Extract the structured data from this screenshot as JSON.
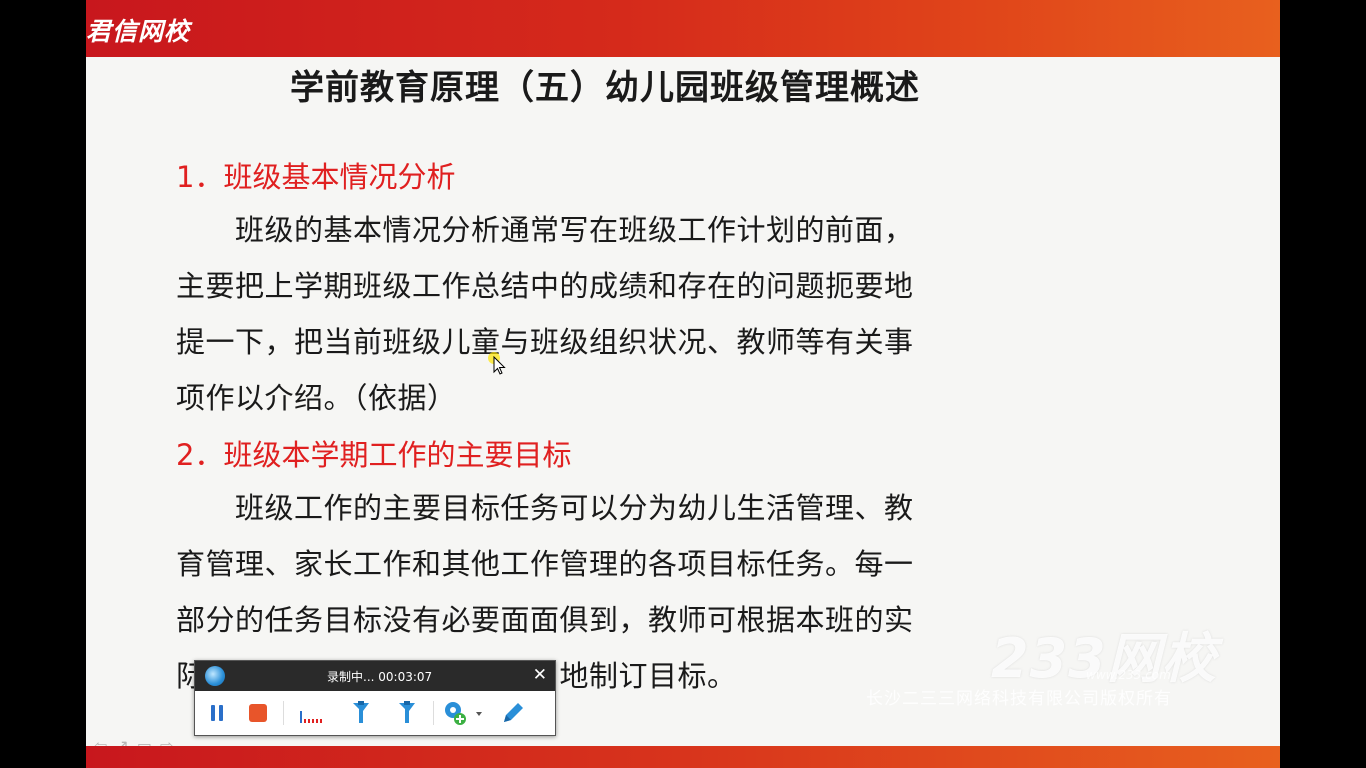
{
  "header": {
    "brand": "君信网校"
  },
  "slide": {
    "title": "学前教育原理（五）幼儿园班级管理概述",
    "section1": {
      "heading": "1．班级基本情况分析",
      "lines": [
        "　　班级的基本情况分析通常写在班级工作计划的前面，",
        "主要把上学期班级工作总结中的成绩和存在的问题扼要地",
        "提一下，把当前班级儿童与班级组织状况、教师等有关事",
        "项作以介绍。（依据）"
      ]
    },
    "section2": {
      "heading": "2．班级本学期工作的主要目标",
      "lines": [
        "　　班级工作的主要目标任务可以分为幼儿生活管理、教",
        "育管理、家长工作和其他工作管理的各项目标任务。每一",
        "部分的任务目标没有必要面面俱到，教师可根据本班的实",
        "际　　　　　　　　　　　　地制订目标。"
      ]
    },
    "watermark": {
      "logo": "233网校",
      "url": "www.233.com",
      "copyright": "长沙二三三网络科技有限公司版权所有"
    }
  },
  "recorder": {
    "status": "录制中...  00:03:07",
    "close": "✕",
    "tools": [
      "pause-icon",
      "stop-icon",
      "audio-level-icon",
      "pen-marker-icon",
      "highlighter-icon",
      "webcam-add-icon",
      "edit-pencil-icon"
    ]
  },
  "colors": {
    "accent_red": "#e02020",
    "bar_red": "#c8171d",
    "bar_orange": "#e8601e"
  }
}
